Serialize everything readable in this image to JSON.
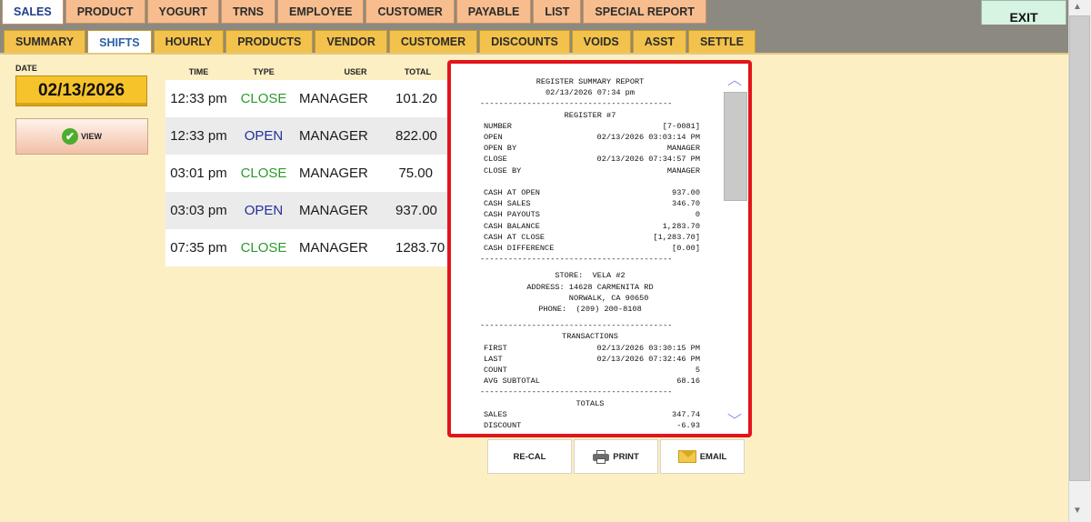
{
  "top_tabs": [
    "SALES",
    "PRODUCT",
    "YOGURT",
    "TRNS",
    "EMPLOYEE",
    "CUSTOMER",
    "PAYABLE",
    "LIST",
    "SPECIAL REPORT"
  ],
  "exit_label": "EXIT",
  "sub_tabs": [
    "SUMMARY",
    "SHIFTS",
    "HOURLY",
    "PRODUCTS",
    "VENDOR",
    "CUSTOMER",
    "DISCOUNTS",
    "VOIDS",
    "ASST",
    "SETTLE"
  ],
  "date": {
    "label": "DATE",
    "value": "02/13/2026"
  },
  "view_label": "VIEW",
  "shifts": {
    "headers": {
      "time": "TIME",
      "type": "TYPE",
      "user": "USER",
      "total": "TOTAL"
    },
    "rows": [
      {
        "time": "12:33 pm",
        "type": "CLOSE",
        "user": "MANAGER",
        "total": "101.20"
      },
      {
        "time": "12:33 pm",
        "type": "OPEN",
        "user": "MANAGER",
        "total": "822.00"
      },
      {
        "time": "03:01 pm",
        "type": "CLOSE",
        "user": "MANAGER",
        "total": "75.00"
      },
      {
        "time": "03:03 pm",
        "type": "OPEN",
        "user": "MANAGER",
        "total": "937.00"
      },
      {
        "time": "07:35 pm",
        "type": "CLOSE",
        "user": "MANAGER",
        "total": "1283.70"
      }
    ]
  },
  "report": {
    "title": "REGISTER SUMMARY REPORT",
    "timestamp": "02/13/2026 07:34 pm",
    "register_heading": "REGISTER #7",
    "register_lines": [
      {
        "k": "NUMBER",
        "v": "[7-0081]"
      },
      {
        "k": "OPEN",
        "v": "02/13/2026 03:03:14 PM"
      },
      {
        "k": "OPEN BY",
        "v": "MANAGER"
      },
      {
        "k": "CLOSE",
        "v": "02/13/2026 07:34:57 PM"
      },
      {
        "k": "CLOSE BY",
        "v": "MANAGER"
      }
    ],
    "cash_lines": [
      {
        "k": "CASH AT OPEN",
        "v": "937.00"
      },
      {
        "k": "CASH SALES",
        "v": "346.70"
      },
      {
        "k": "CASH PAYOUTS",
        "v": "0"
      },
      {
        "k": "CASH BALANCE",
        "v": "1,283.70"
      },
      {
        "k": "CASH AT CLOSE",
        "v": "[1,283.70]"
      },
      {
        "k": "CASH DIFFERENCE",
        "v": "[0.00]"
      }
    ],
    "store_lines": [
      "STORE:  VELA #2",
      "ADDRESS: 14628 CARMENITA RD",
      "        NORWALK, CA 90650",
      "PHONE:  (209) 200-8108"
    ],
    "transactions_heading": "TRANSACTIONS",
    "transactions_lines": [
      {
        "k": "FIRST",
        "v": "02/13/2026 03:30:15 PM"
      },
      {
        "k": "LAST",
        "v": "02/13/2026 07:32:46 PM"
      },
      {
        "k": "COUNT",
        "v": "5"
      },
      {
        "k": "AVG SUBTOTAL",
        "v": "68.16"
      }
    ],
    "totals_heading": "TOTALS",
    "totals_lines": [
      {
        "k": "SALES",
        "v": "347.74"
      },
      {
        "k": "DISCOUNT",
        "v": "-6.93"
      }
    ],
    "dashes": "-----------------------------------------"
  },
  "buttons": {
    "recal": "RE-CAL",
    "print": "PRINT",
    "email": "EMAIL"
  }
}
